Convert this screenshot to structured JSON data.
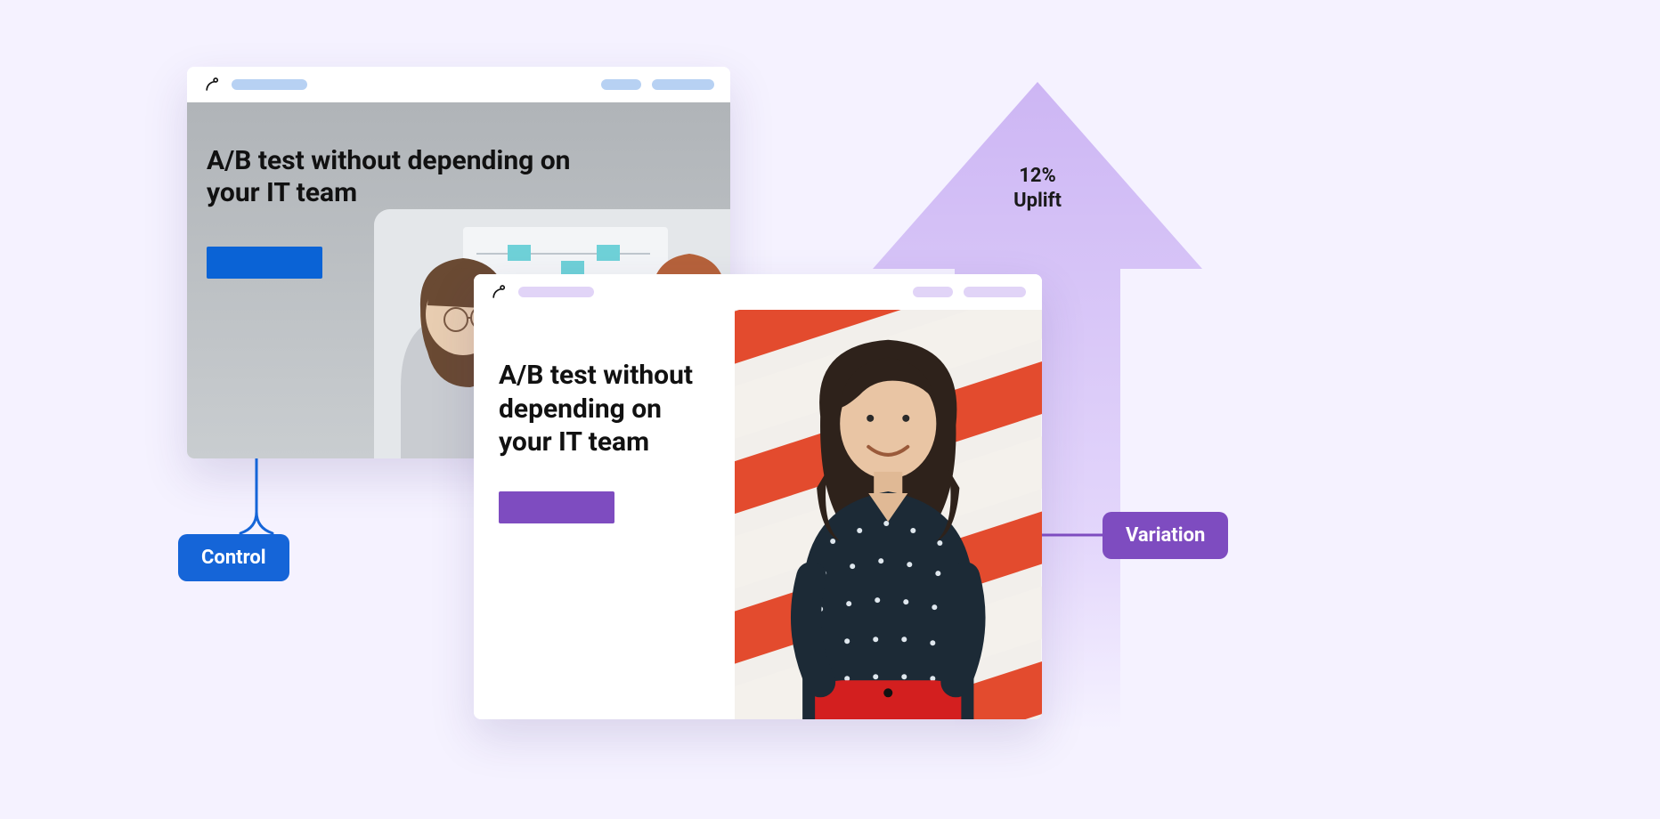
{
  "control": {
    "headline": "A/B test without depending on your IT team",
    "label": "Control"
  },
  "variation": {
    "headline": "A/B test without depending on your IT team",
    "label": "Variation"
  },
  "uplift": {
    "value": "12%",
    "caption": "Uplift"
  },
  "colors": {
    "control_accent": "#1565d8",
    "variation_accent": "#7e4cc0",
    "arrow_fill": "#cdb6f4"
  }
}
